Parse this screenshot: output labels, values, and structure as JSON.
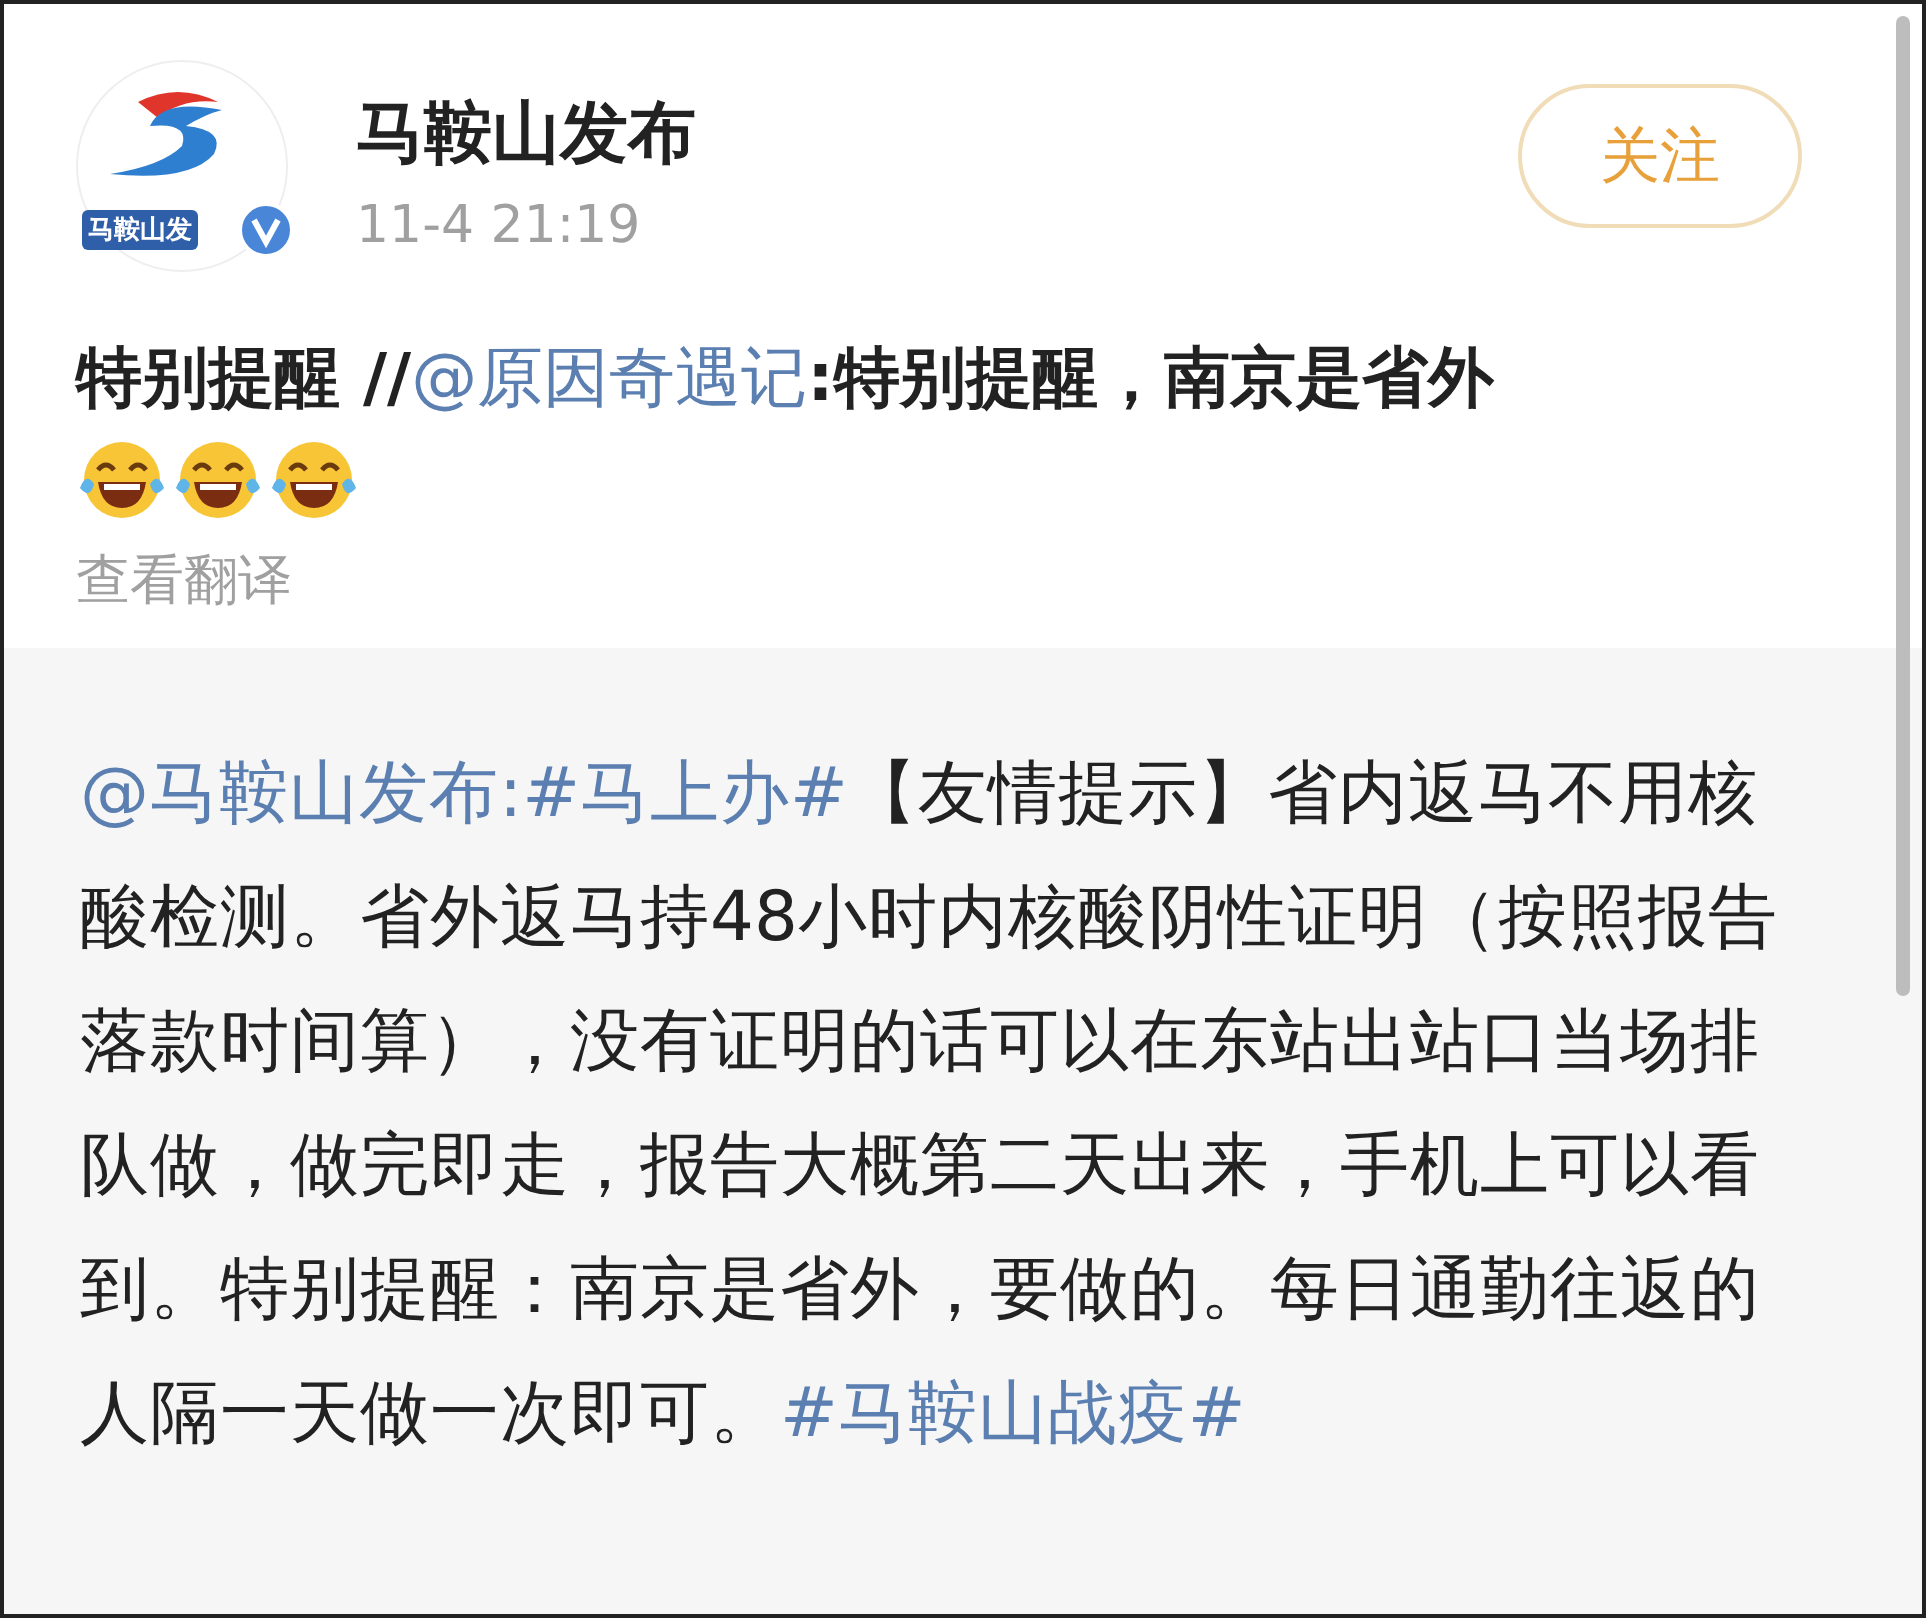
{
  "post": {
    "avatar_text": "马鞍山发",
    "author": "马鞍山发布",
    "time": "11-4 21:19",
    "follow_button": "关注",
    "text": [
      {
        "kind": "text",
        "text": "特别提醒 //"
      },
      {
        "kind": "link",
        "text": "@原因奇遇记"
      },
      {
        "kind": "text",
        "text": ":特别提醒，南京是省外"
      }
    ],
    "emojis": [
      {
        "kind": "laugh-cry"
      },
      {
        "kind": "laugh-cry"
      },
      {
        "kind": "laugh-cry"
      }
    ],
    "translate_link": "查看翻译"
  },
  "repost": {
    "text": [
      {
        "kind": "link",
        "text": "@马鞍山发布:"
      },
      {
        "kind": "link",
        "text": "#马上办#"
      },
      {
        "kind": "text",
        "text": "【友情提示】省内返马不用核酸检测。省外返马持48小时内核酸阴性证明（按照报告落款时间算），没有证明的话可以在东站出站口当场排队做，做完即走，报告大概第二天出来，手机上可以看到。特别提醒：南京是省外，要做的。每日通勤往返的人隔一天做一次即可。"
      },
      {
        "kind": "link",
        "text": "#马鞍山战疫#"
      }
    ]
  }
}
